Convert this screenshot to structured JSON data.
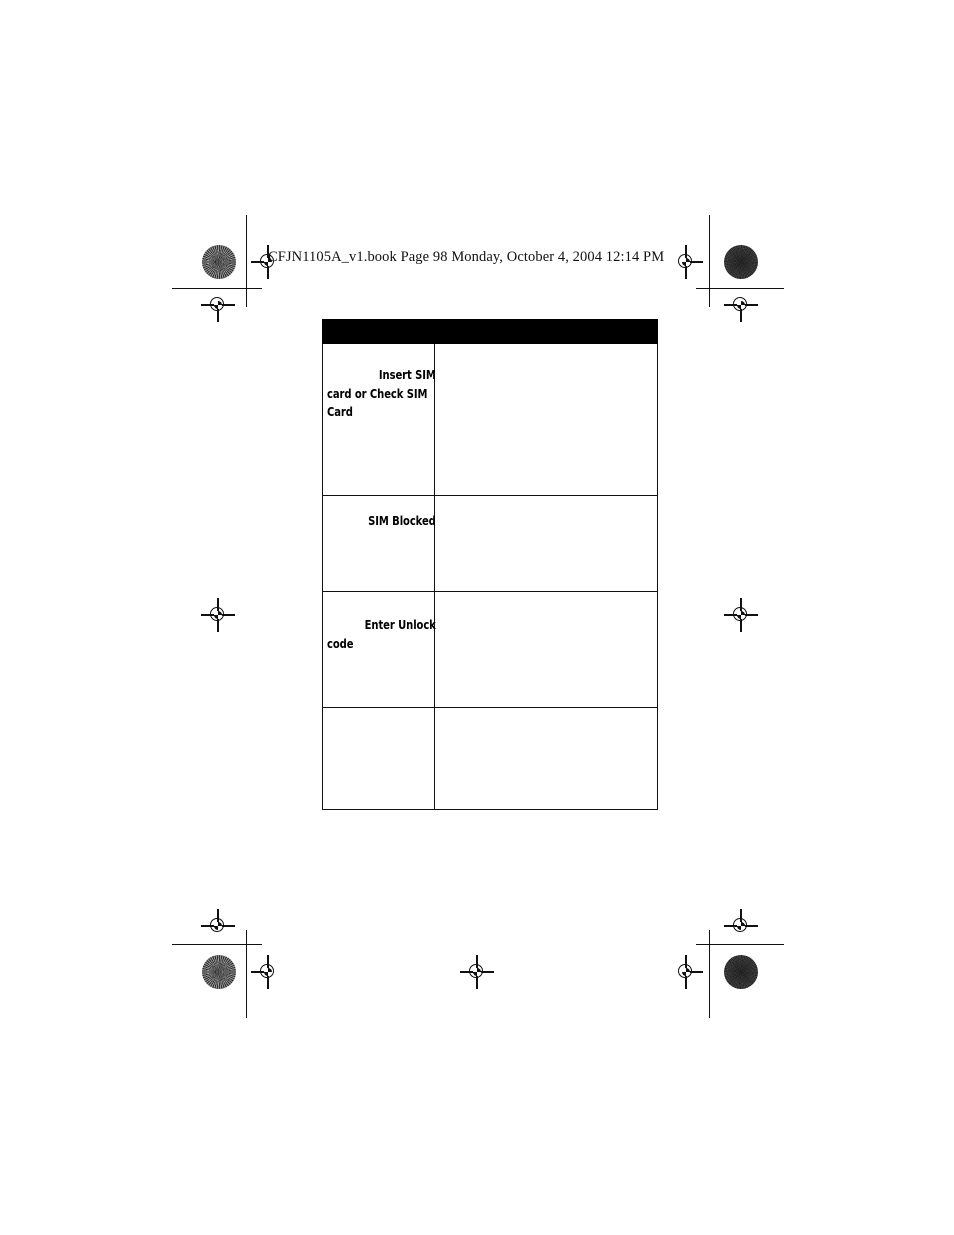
{
  "document": {
    "running_header": "CFJN1105A_v1.book  Page 98  Monday, October 4, 2004  12:14 PM",
    "page_number": "98",
    "book_file": "CFJN1105A_v1.book",
    "date_text": "Monday, October 4, 2004",
    "time_text": "12:14 PM"
  },
  "colors": {
    "page_background": "#ffffff",
    "ink": "#000000",
    "header_bar": "#000000",
    "rule": "#111111"
  },
  "table": {
    "header_bar": {
      "left_label": "",
      "right_label": ""
    },
    "columns": [
      {
        "key": "message",
        "header": ""
      },
      {
        "key": "description",
        "header": ""
      }
    ],
    "rows": [
      {
        "message_lead": "Insert SIM",
        "message_rest": "card or Check SIM Card",
        "message_full": "Insert SIM card or Check SIM Card",
        "description": ""
      },
      {
        "message_lead": "SIM Blocked",
        "message_rest": "",
        "message_full": "SIM Blocked",
        "description": ""
      },
      {
        "message_lead": "Enter Unlock",
        "message_rest": "code",
        "message_full": "Enter Unlock code",
        "description": ""
      },
      {
        "message_lead": "",
        "message_rest": "",
        "message_full": "",
        "description": ""
      }
    ]
  },
  "printer_marks": {
    "registration_target_name": "registration-target",
    "halftone_name": "halftone-density-patch",
    "trim_rule_name": "trim-rule"
  }
}
